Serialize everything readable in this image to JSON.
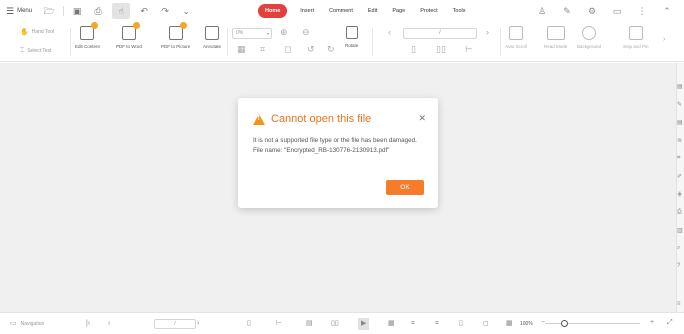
{
  "menubar": {
    "menu_label": "Menu",
    "tabs": [
      {
        "label": "Home",
        "active": true
      },
      {
        "label": "Insert",
        "active": false
      },
      {
        "label": "Comment",
        "active": false
      },
      {
        "label": "Edit",
        "active": false
      },
      {
        "label": "Page",
        "active": false
      },
      {
        "label": "Protect",
        "active": false
      },
      {
        "label": "Tools",
        "active": false
      }
    ],
    "active_tab_color": "#e2403c"
  },
  "ribbon": {
    "hand_tool": "Hand Tool",
    "select_text": "Select Text",
    "edit_content": "Edit Content",
    "pdf_to_word": "PDF to Word",
    "pdf_to_picture": "PDF to Picture",
    "annotate": "Annotate",
    "zoom_value": "0%",
    "rotate": "Rotate",
    "page_value": "/",
    "auto_scroll": "Auto Scroll",
    "read_mode": "Read Mode",
    "background": "Background",
    "snip_and_pin": "Snip and Pin"
  },
  "dialog": {
    "title": "Cannot open this file",
    "message": "It is not a supported file type or the file has been damaged.",
    "file_line": "File name: \"Encrypted_RB-130776-2130913.pdf\"",
    "ok_label": "OK",
    "accent": "#f57c2b"
  },
  "statusbar": {
    "navigation": "Navigation",
    "page_value": "/",
    "zoom": "100%"
  }
}
